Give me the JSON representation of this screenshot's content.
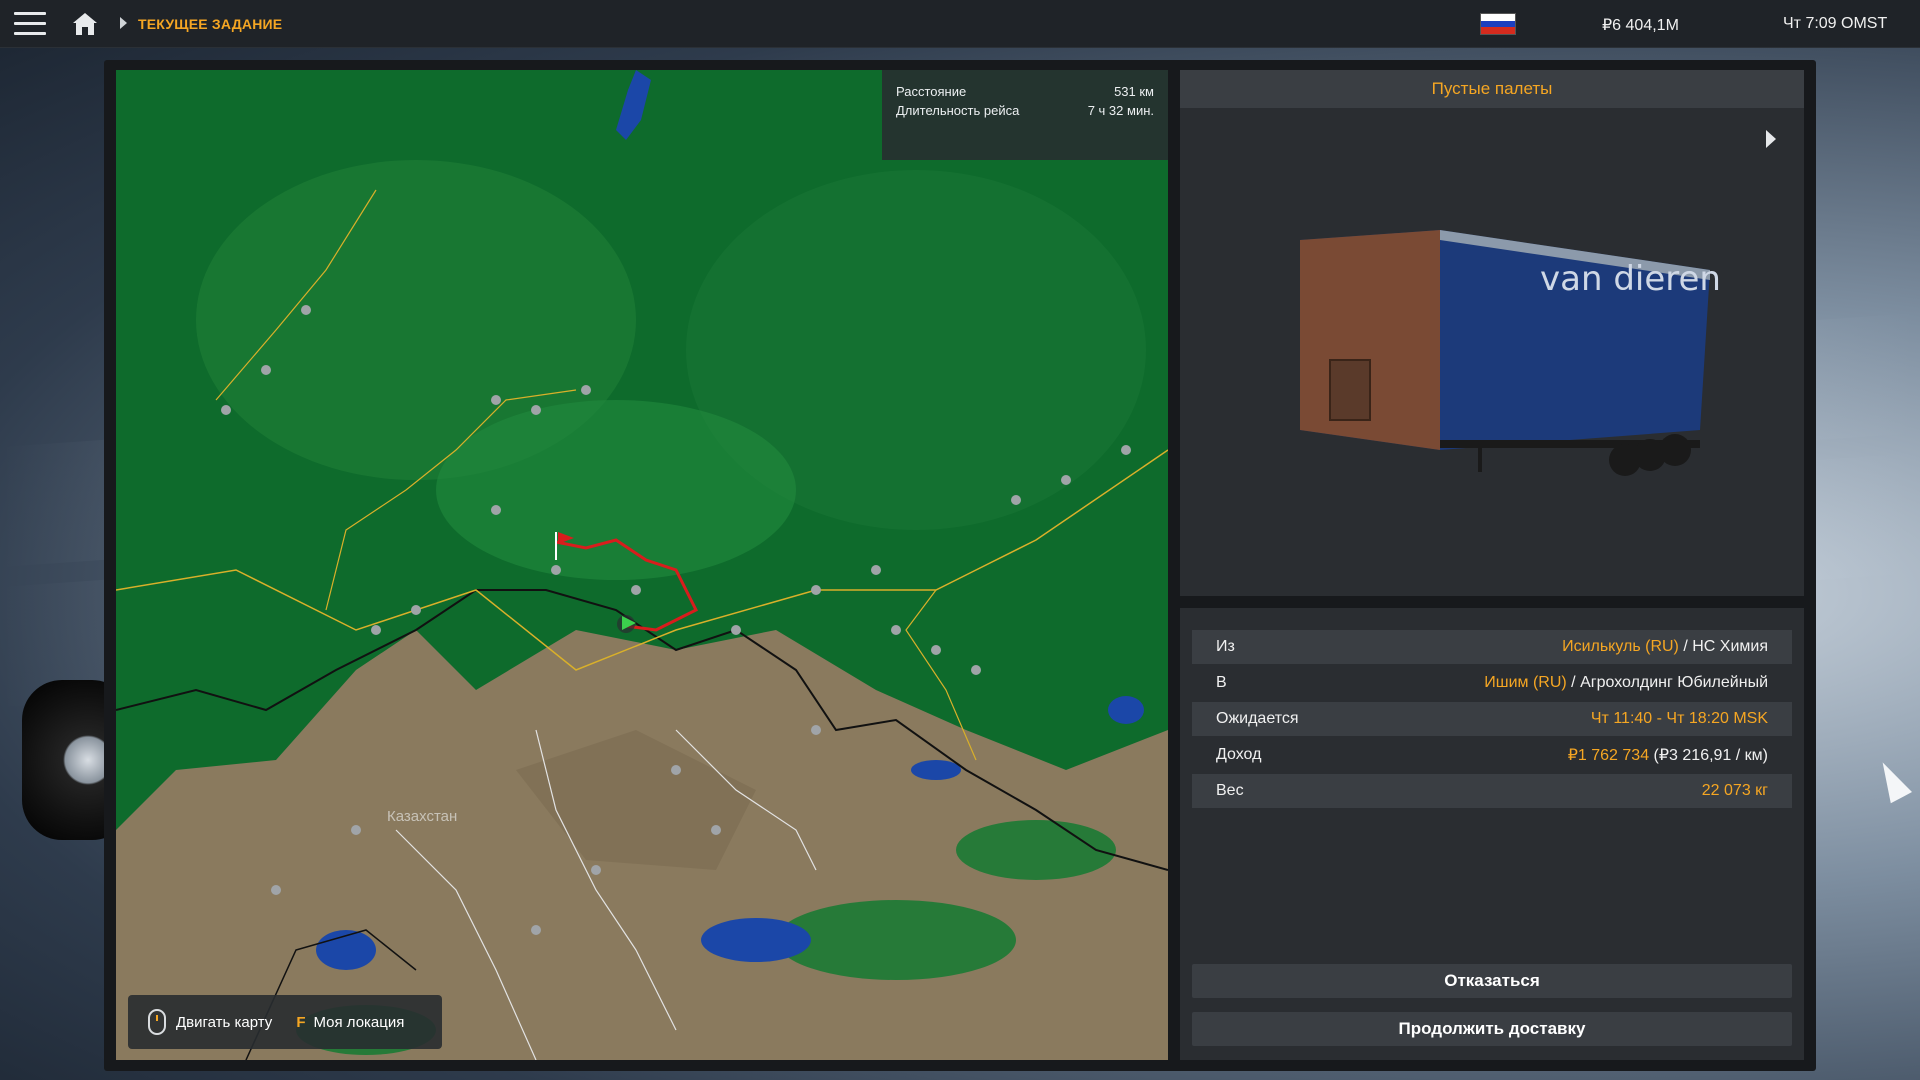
{
  "topbar": {
    "breadcrumb": "ТЕКУЩЕЕ ЗАДАНИЕ",
    "money": "₽6 404,1М",
    "clock": "Чт 7:09 OMST",
    "flag_colors": [
      "#ffffff",
      "#1c3fbf",
      "#d52b1e"
    ]
  },
  "route": {
    "distance_label": "Расстояние",
    "distance_value": "531 км",
    "duration_label": "Длительность рейса",
    "duration_value": "7 ч 32 мин."
  },
  "map": {
    "region_label": "Казахстан",
    "controls": {
      "move_label": "Двигать карту",
      "location_key": "F",
      "location_label": "Моя локация"
    }
  },
  "cargo": {
    "title": "Пустые палеты",
    "trailer_brand": "van dieren"
  },
  "details": {
    "from_label": "Из",
    "from_city": "Исилькуль (RU)",
    "from_company": " / НС Химия",
    "to_label": "В",
    "to_city": "Ишим (RU)",
    "to_company": " / Агрохолдинг Юбилейный",
    "expected_label": "Ожидается",
    "expected_value": "Чт 11:40 - Чт 18:20 MSK",
    "income_label": "Доход",
    "income_value": "₽1 762 734",
    "income_rate": " (₽3 216,91 / км)",
    "weight_label": "Вес",
    "weight_value": "22 073 кг"
  },
  "buttons": {
    "decline": "Отказаться",
    "continue": "Продолжить доставку"
  },
  "colors": {
    "accent": "#f5a623",
    "forest": "#0e6b2c",
    "steppe": "#8a7a5e",
    "water": "#1b47a8",
    "route": "#d81d1d"
  }
}
